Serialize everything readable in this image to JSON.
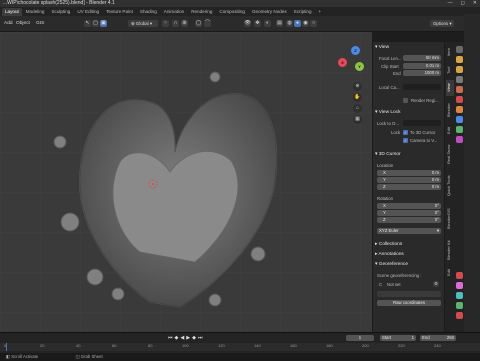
{
  "window": {
    "title": "...WIP\\chocolate splash(2525).blend] - Blender 4.1",
    "controls": [
      "—",
      "◻",
      "✕"
    ]
  },
  "workspace_tabs": [
    {
      "label": "Layout",
      "active": true
    },
    {
      "label": "Modeling"
    },
    {
      "label": "Sculpting"
    },
    {
      "label": "UV Editing"
    },
    {
      "label": "Texture Paint"
    },
    {
      "label": "Shading"
    },
    {
      "label": "Animation"
    },
    {
      "label": "Rendering"
    },
    {
      "label": "Compositing"
    },
    {
      "label": "Geometry Nodes"
    },
    {
      "label": "Scripting"
    },
    {
      "label": "+"
    }
  ],
  "scene": {
    "icon": "scene-icon",
    "label": "Scene"
  },
  "viewport_menu": {
    "add": "Add",
    "object": "Object",
    "gis": "GIS"
  },
  "viewport_header": {
    "transform_orientation": "Global",
    "options": "Options",
    "snapping_icon": "magnet-icon",
    "proportional_icon": "circle-icon",
    "view_icons": [
      "wireframe-icon",
      "solid-icon",
      "material-icon",
      "rendered-icon"
    ]
  },
  "gizmo_axes": {
    "x": "X",
    "y": "Y",
    "z": "Z"
  },
  "n_panel": {
    "view_section": "View",
    "focal_length_label": "Focal Len...",
    "focal_length": "50 mm",
    "clip_start_label": "Clip Start",
    "clip_start": "0.01 m",
    "clip_end_label": "End",
    "clip_end": "1000 m",
    "local_camera_label": "Local Ca...",
    "render_region_label": "Render Regi...",
    "view_lock_section": "View Lock",
    "lock_to_object_label": "Lock to O...",
    "lock_label": "Lock",
    "to_3d_cursor_label": "To 3D Cursor",
    "camera_to_view_label": "Camera to V...",
    "cursor_section": "3D Cursor",
    "location_label": "Location",
    "loc": [
      {
        "axis": "X",
        "value": "0 m"
      },
      {
        "axis": "Y",
        "value": "0 m"
      },
      {
        "axis": "Z",
        "value": "0 m"
      }
    ],
    "rotation_label": "Rotation",
    "rot": [
      {
        "axis": "X",
        "value": "0°"
      },
      {
        "axis": "Y",
        "value": "0°"
      },
      {
        "axis": "Z",
        "value": "0°"
      }
    ],
    "rotation_mode": "XYZ Euler",
    "collections_section": "Collections",
    "annotations_section": "Annotations",
    "georeference_section": "Georeference",
    "scene_georef_label": "Scene georeferencing :",
    "crs_label": "C",
    "crs_value": "Not set",
    "add_coords_label": "Raw coordinates"
  },
  "side_tabs": [
    "Item",
    "Tool",
    "View",
    "Blender",
    "Edit",
    "Real Snow",
    "Quick Tools",
    "BlenderGIS",
    "Blender Kit",
    "Edit"
  ],
  "timeline": {
    "playback_icons": [
      "jump-start-icon",
      "prev-key-icon",
      "play-reverse-icon",
      "play-icon",
      "next-key-icon",
      "jump-end-icon"
    ],
    "current_frame": "1",
    "start_label": "Start",
    "start": "1",
    "end_label": "End",
    "end": "250",
    "ticks": [
      "0",
      "20",
      "40",
      "60",
      "80",
      "100",
      "120",
      "140",
      "160",
      "180",
      "200",
      "220",
      "240"
    ]
  },
  "statusbar": {
    "left": "Scroll Activate",
    "middle": "Grab Sheet"
  },
  "colors": {
    "accent": "#4772b3",
    "x_axis": "#e8495a",
    "y_axis": "#8bc640",
    "z_axis": "#4b8ae8"
  }
}
